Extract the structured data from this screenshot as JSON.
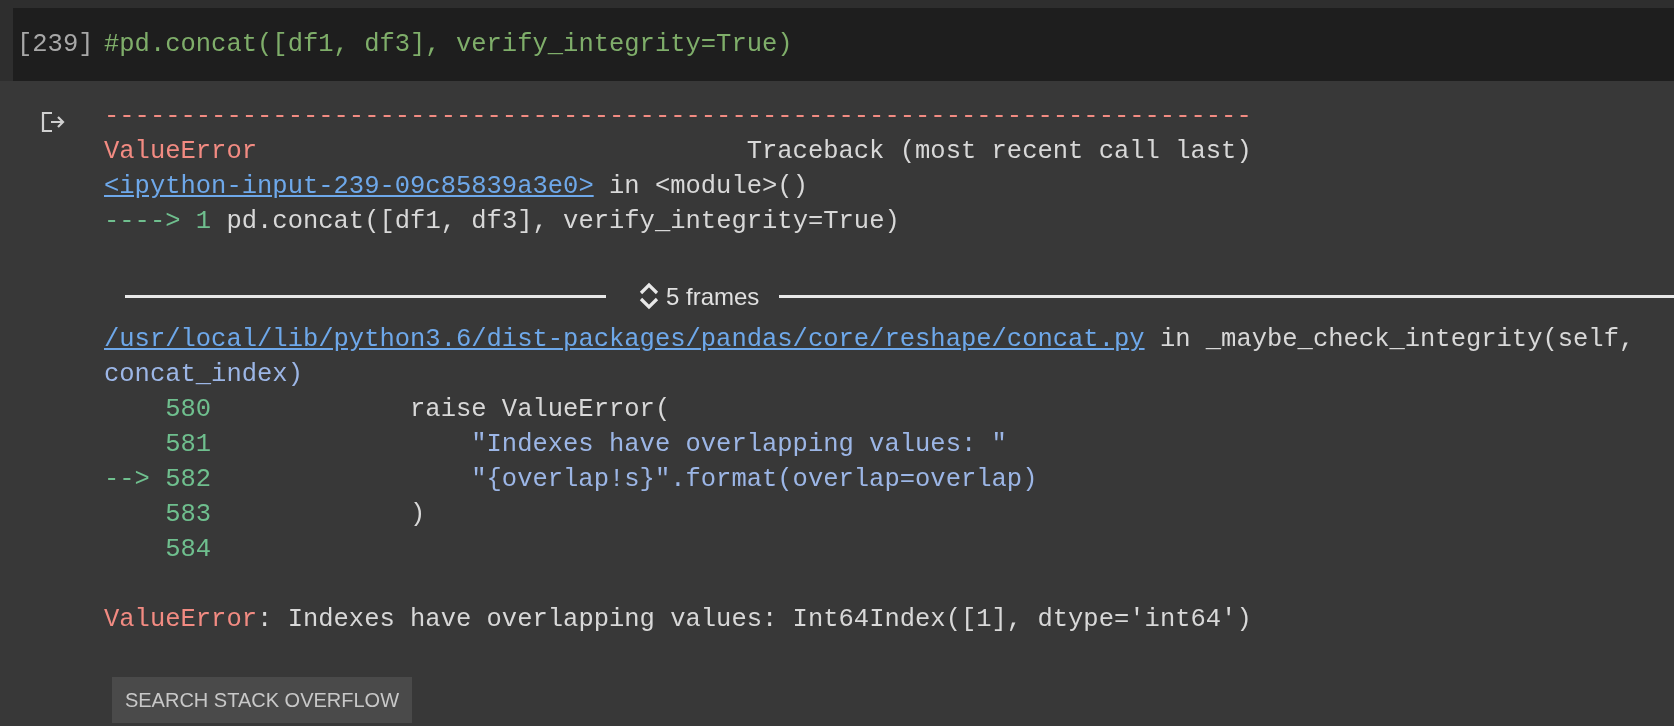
{
  "input": {
    "execution_count": "[239]",
    "code": "#pd.concat([df1, df3], verify_integrity=True)"
  },
  "output": {
    "separator": "---------------------------------------------------------------------------",
    "error_name": "ValueError",
    "traceback_header": "Traceback (most recent call last)",
    "frames": [
      {
        "kind": "inline",
        "location": "<ipython-input-239-09c85839a3e0>",
        "context": "in <module>()",
        "lines": [
          {
            "marker": "---->",
            "number": "1",
            "code": "pd.concat([df1, df3], verify_integrity=True)"
          }
        ]
      },
      {
        "kind": "collapsed",
        "label": "5 frames"
      },
      {
        "kind": "listing",
        "location": "/usr/local/lib/python3.6/dist-packages/pandas/core/reshape/concat.py",
        "context": "in _maybe_check_integrity(self,",
        "context_more": "concat_index)",
        "lines": [
          {
            "number": "580",
            "code": "raise ValueError("
          },
          {
            "number": "581",
            "code": "    \"Indexes have overlapping values: \""
          },
          {
            "marker": "-->",
            "number": "582",
            "code": "    \"{overlap!s}\".format(overlap=overlap)"
          },
          {
            "number": "583",
            "code": ")"
          },
          {
            "number": "584"
          }
        ]
      }
    ],
    "error": {
      "name": "ValueError",
      "message": ": Indexes have overlapping values: Int64Index([1], dtype='int64')"
    },
    "button": "SEARCH STACK OVERFLOW"
  }
}
